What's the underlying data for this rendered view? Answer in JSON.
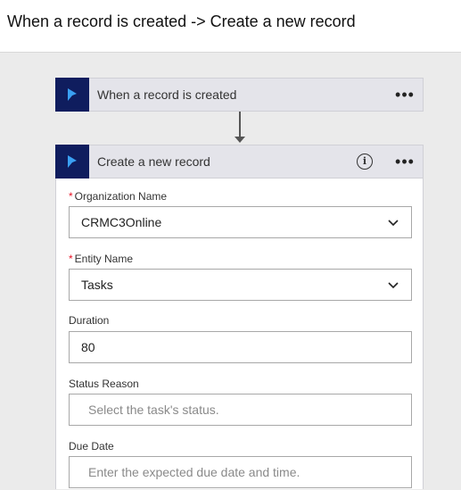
{
  "page": {
    "title": "When a record is created -> Create a new record"
  },
  "trigger": {
    "title": "When a record is created",
    "logo_icon": "dynamics-logo-icon",
    "menu_icon": "more-dots-icon"
  },
  "connector": {
    "icon": "down-arrow-icon"
  },
  "action": {
    "title": "Create a new record",
    "logo_icon": "dynamics-logo-icon",
    "info_icon": "info-icon",
    "info_glyph": "i",
    "menu_icon": "more-dots-icon",
    "fields": {
      "organization": {
        "required_mark": "*",
        "label": "Organization Name",
        "value": "CRMC3Online",
        "type": "dropdown"
      },
      "entity": {
        "required_mark": "*",
        "label": "Entity Name",
        "value": "Tasks",
        "type": "dropdown"
      },
      "duration": {
        "label": "Duration",
        "value": "80",
        "type": "text"
      },
      "status_reason": {
        "label": "Status Reason",
        "placeholder": "Select the task's status.",
        "type": "text"
      },
      "due_date": {
        "label": "Due Date",
        "placeholder": "Enter the expected due date and time.",
        "type": "text"
      }
    }
  },
  "colors": {
    "logo_bg": "#0f1d5e",
    "logo_fg": "#3aa0f3",
    "required": "#e81123",
    "header_bg": "#e4e4ea",
    "canvas_bg": "#ebebeb"
  }
}
